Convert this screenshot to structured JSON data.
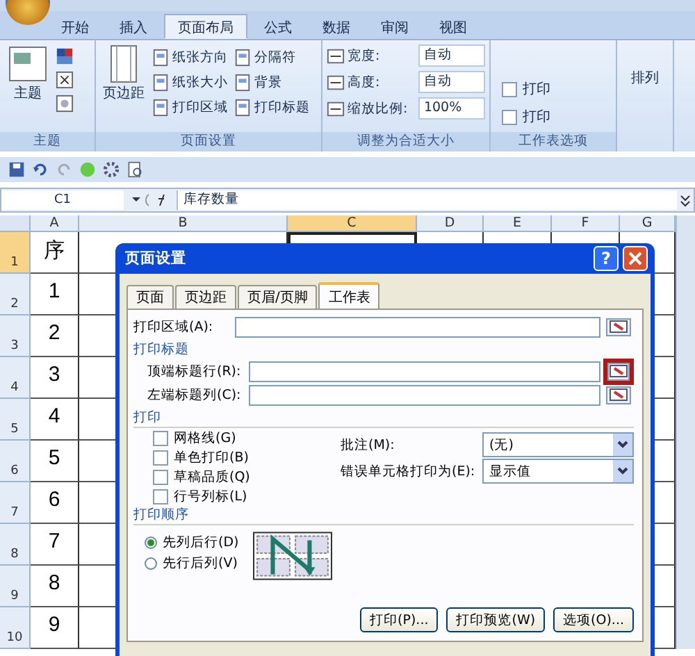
{
  "ribbon": {
    "tabs": [
      {
        "label": "开始",
        "selected": false
      },
      {
        "label": "插入",
        "selected": false
      },
      {
        "label": "页面布局",
        "selected": true
      },
      {
        "label": "公式",
        "selected": false
      },
      {
        "label": "数据",
        "selected": false
      },
      {
        "label": "审阅",
        "selected": false
      },
      {
        "label": "视图",
        "selected": false
      }
    ],
    "groups": [
      {
        "kind": "theme",
        "title": "主题",
        "large": "主题"
      },
      {
        "kind": "page_setup",
        "title": "页面设置",
        "large": "页边距",
        "commands": [
          "纸张方向",
          "纸张大小",
          "打印区域",
          "分隔符",
          "背景",
          "打印标题"
        ]
      },
      {
        "kind": "scale",
        "title": "调整为合适大小",
        "fields": [
          {
            "label": "宽度:",
            "value": "自动"
          },
          {
            "label": "高度:",
            "value": "自动"
          },
          {
            "label": "缩放比例:",
            "value": "100%"
          }
        ]
      },
      {
        "kind": "sheet_options",
        "title": "工作表选项",
        "checks": [
          {
            "label": "打印",
            "checked": false
          },
          {
            "label": "打印",
            "checked": false
          }
        ]
      },
      {
        "kind": "arrange",
        "large": "排列"
      }
    ]
  },
  "formula_bar": {
    "name_box": "C1",
    "formula": "库存数量"
  },
  "sheet": {
    "columns": [
      {
        "label": "A",
        "selected": false
      },
      {
        "label": "B",
        "selected": false
      },
      {
        "label": "C",
        "selected": true
      },
      {
        "label": "D",
        "selected": false
      },
      {
        "label": "E",
        "selected": false
      },
      {
        "label": "F",
        "selected": false
      },
      {
        "label": "G",
        "selected": false
      }
    ],
    "rows": [
      {
        "header": "1",
        "selected": true,
        "a": "序"
      },
      {
        "header": "2",
        "selected": false,
        "a": "1"
      },
      {
        "header": "3",
        "selected": false,
        "a": "2"
      },
      {
        "header": "4",
        "selected": false,
        "a": "3"
      },
      {
        "header": "5",
        "selected": false,
        "a": "4"
      },
      {
        "header": "6",
        "selected": false,
        "a": "5"
      },
      {
        "header": "7",
        "selected": false,
        "a": "6"
      },
      {
        "header": "8",
        "selected": false,
        "a": "7"
      },
      {
        "header": "9",
        "selected": false,
        "a": "8"
      },
      {
        "header": "10",
        "selected": false,
        "a": "9"
      }
    ]
  },
  "dialog": {
    "title": "页面设置",
    "help": "?",
    "tabs": [
      {
        "label": "页面",
        "selected": false
      },
      {
        "label": "页边距",
        "selected": false
      },
      {
        "label": "页眉/页脚",
        "selected": false
      },
      {
        "label": "工作表",
        "selected": true
      }
    ],
    "print_area": {
      "label": "打印区域(A):"
    },
    "print_titles": {
      "heading": "打印标题",
      "fields": [
        {
          "label": "顶端标题行(R):",
          "highlighted": true
        },
        {
          "label": "左端标题列(C):",
          "highlighted": false
        }
      ]
    },
    "print": {
      "heading": "打印",
      "checks": [
        {
          "label": "网格线(G)",
          "checked": false
        },
        {
          "label": "单色打印(B)",
          "checked": false
        },
        {
          "label": "草稿品质(Q)",
          "checked": false
        },
        {
          "label": "行号列标(L)",
          "checked": false
        }
      ],
      "selects": [
        {
          "label": "批注(M):",
          "value": "(无)"
        },
        {
          "label": "错误单元格打印为(E):",
          "value": "显示值"
        }
      ]
    },
    "order": {
      "heading": "打印顺序",
      "options": [
        {
          "label": "先列后行(D)",
          "selected": true
        },
        {
          "label": "先行后列(V)",
          "selected": false
        }
      ]
    },
    "buttons": [
      "打印(P)...",
      "打印预览(W)",
      "选项(O)..."
    ]
  }
}
